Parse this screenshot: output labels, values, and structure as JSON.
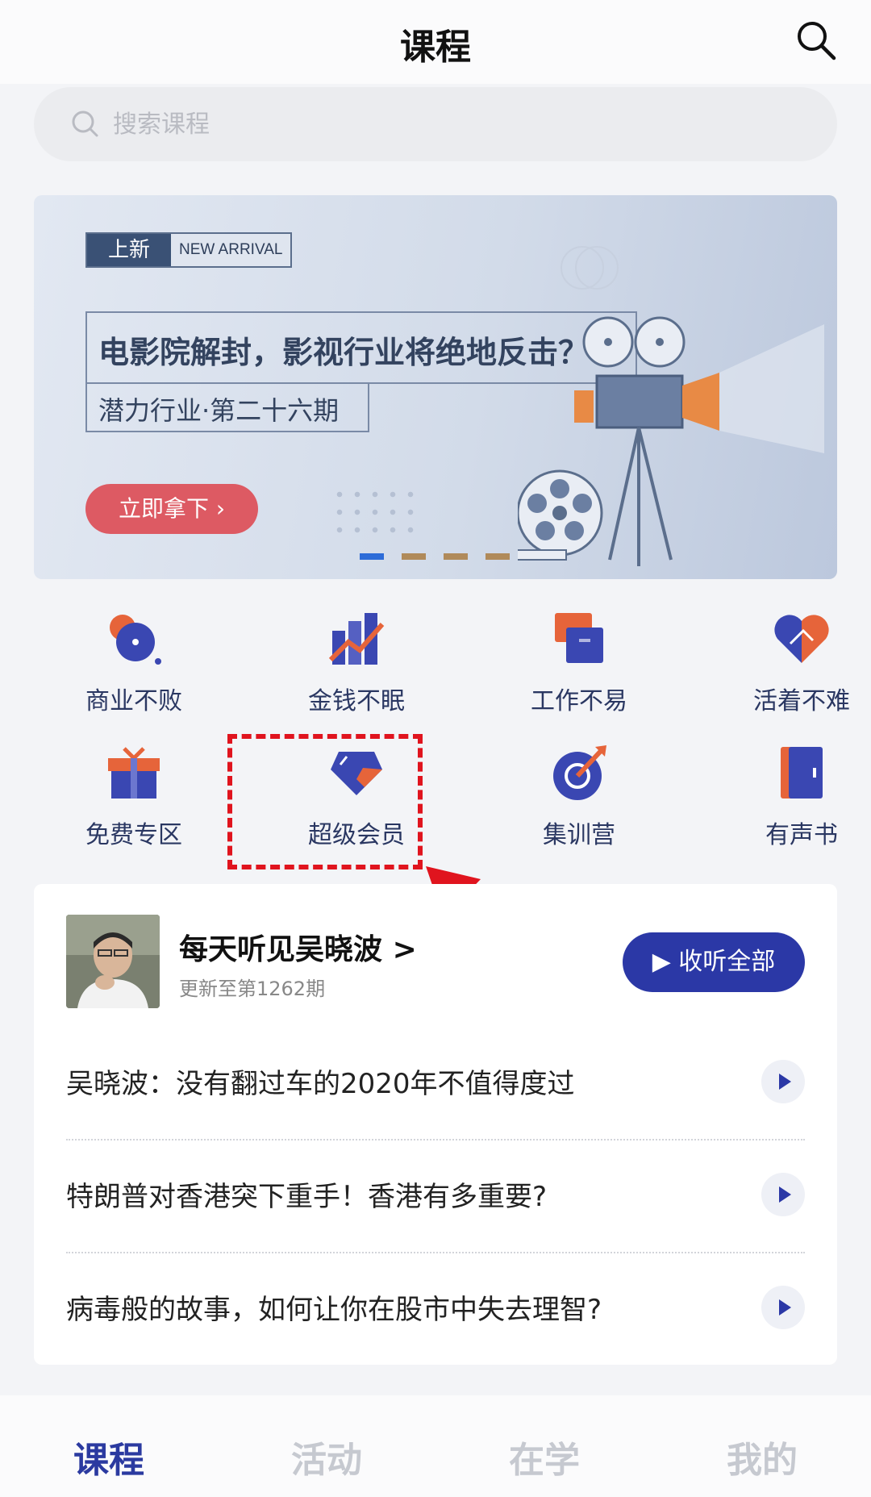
{
  "header": {
    "title": "课程",
    "search_icon": "search-icon"
  },
  "search": {
    "placeholder": "搜索课程"
  },
  "banner": {
    "tag_cn": "上新",
    "tag_en": "NEW ARRIVAL",
    "headline": "电影院解封，影视行业将绝地反击？",
    "subline": "潜力行业·第二十六期",
    "cta": "立即拿下 ›",
    "indicator_count": 4,
    "active_indicator": 1
  },
  "categories": [
    {
      "label": "商业不败",
      "icon": "business-icon"
    },
    {
      "label": "金钱不眠",
      "icon": "money-chart-icon"
    },
    {
      "label": "工作不易",
      "icon": "work-icon"
    },
    {
      "label": "活着不难",
      "icon": "heart-icon"
    },
    {
      "label": "免费专区",
      "icon": "gift-icon"
    },
    {
      "label": "超级会员",
      "icon": "diamond-icon"
    },
    {
      "label": "集训营",
      "icon": "target-icon"
    },
    {
      "label": "有声书",
      "icon": "book-icon"
    }
  ],
  "column": {
    "title": "每天听见吴晓波",
    "title_chevron": ">",
    "subtitle": "更新至第1262期",
    "listen_all": "▶ 收听全部",
    "episodes": [
      "吴晓波：没有翻过车的2020年不值得度过",
      "特朗普对香港突下重手！香港有多重要?",
      "病毒般的故事，如何让你在股市中失去理智?"
    ]
  },
  "tabs": [
    {
      "label": "课程",
      "active": true
    },
    {
      "label": "活动",
      "active": false
    },
    {
      "label": "在学",
      "active": false
    },
    {
      "label": "我的",
      "active": false
    }
  ],
  "colors": {
    "accent": "#2b38a6",
    "icon_orange": "#e6643a",
    "cta_red": "#dd5a63",
    "highlight_red": "#e0141e"
  }
}
